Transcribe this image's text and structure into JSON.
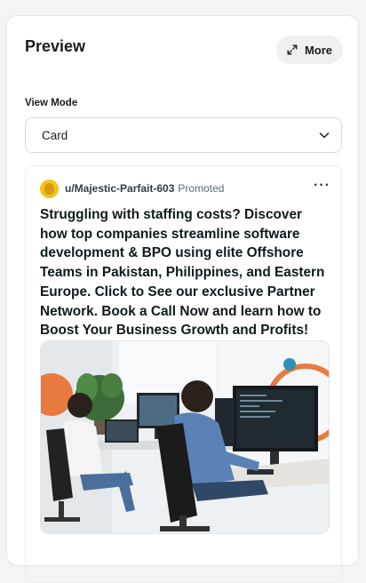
{
  "header": {
    "title": "Preview",
    "more_label": "More",
    "more_icon": "expand-icon"
  },
  "view_mode": {
    "label": "View Mode",
    "selected": "Card",
    "icon": "chevron-down-icon"
  },
  "post": {
    "username": "u/Majestic-Parfait-603",
    "promoted_label": "Promoted",
    "menu_icon": "more-dots-icon",
    "headline": "Struggling with staffing costs? Discover how top companies streamline software development & BPO using elite Offshore Teams in Pakistan, Philippines, and Eastern Europe. Click to See our exclusive Partner Network. Book a Call Now and learn how to Boost Your Business Growth and Profits!",
    "image": "office-workers-at-computers-photo"
  },
  "colors": {
    "panel_bg": "#ffffff",
    "page_bg": "#f3f4f6",
    "button_bg": "#eef0f2",
    "avatar": "#f4c21b",
    "muted_text": "#576f76"
  }
}
